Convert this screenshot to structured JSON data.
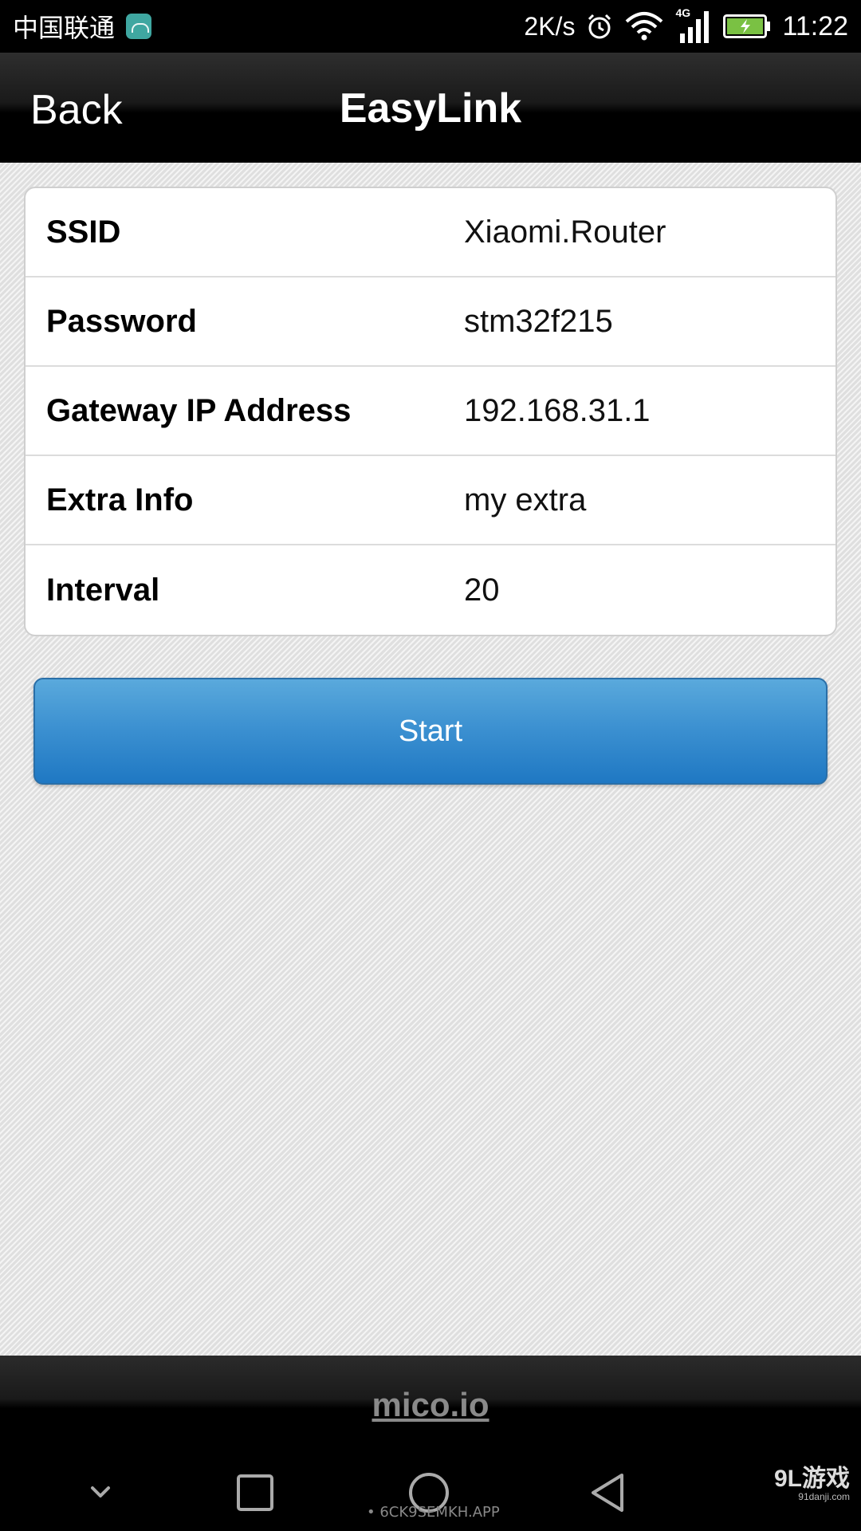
{
  "status_bar": {
    "carrier": "中国联通",
    "speed": "2K/s",
    "network_label": "4G",
    "time": "11:22",
    "icons": [
      "android-notification-icon",
      "alarm-clock-icon",
      "wifi-icon",
      "cellular-signal-icon",
      "battery-charging-icon"
    ]
  },
  "nav": {
    "back_label": "Back",
    "title": "EasyLink"
  },
  "form": {
    "rows": [
      {
        "label": "SSID",
        "value": "Xiaomi.Router"
      },
      {
        "label": "Password",
        "value": "stm32f215"
      },
      {
        "label": "Gateway IP Address",
        "value": "192.168.31.1"
      },
      {
        "label": "Extra Info",
        "value": "my extra"
      },
      {
        "label": "Interval",
        "value": "20"
      }
    ]
  },
  "start_button": {
    "label": "Start"
  },
  "footer": {
    "link": "mico.io"
  },
  "system_nav": {
    "icons": [
      "collapse-chevron-icon",
      "recents-square-icon",
      "home-circle-icon",
      "back-triangle-icon"
    ]
  },
  "watermark": "• 6CK9SEMKH.APP",
  "logo": {
    "text": "9L游戏",
    "sub": "91danji.com"
  },
  "colors": {
    "button_blue": "#3a8fd0",
    "bar_black": "#000000",
    "content_bg": "#e6e6e6"
  }
}
